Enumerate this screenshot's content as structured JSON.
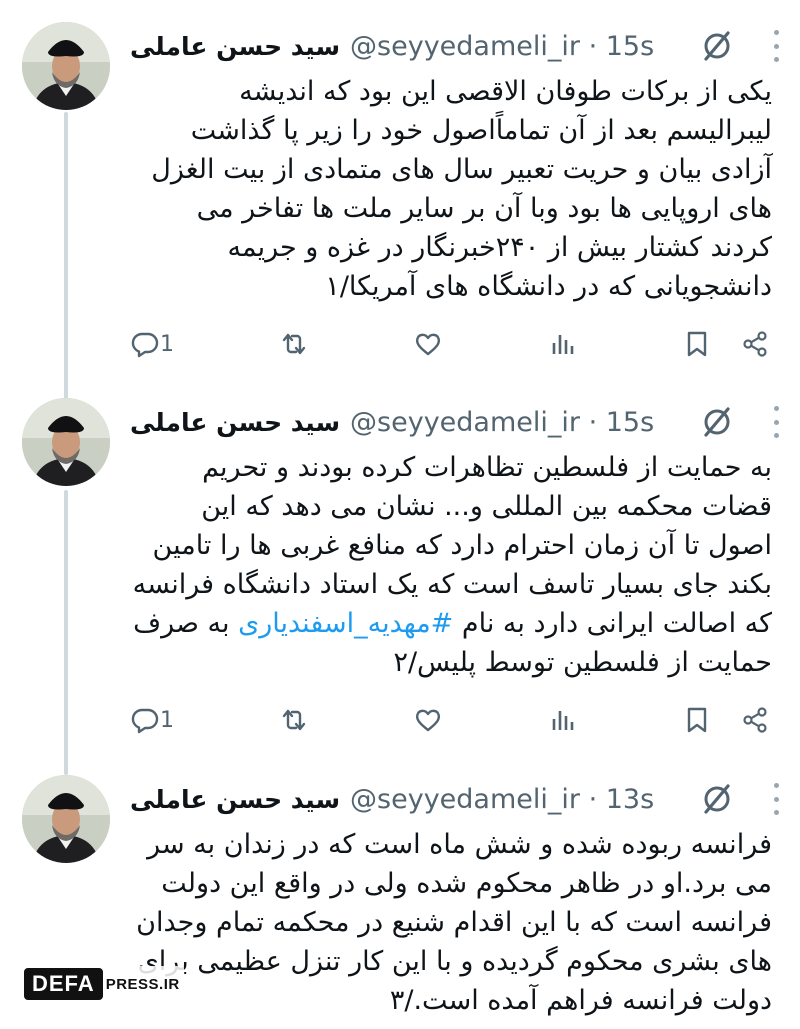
{
  "tweets": [
    {
      "display_name": "سید حسن عاملی",
      "handle": "@seyyedameli_ir · 15s",
      "text": "یکی از برکات طوفان الاقصی این بود که اندیشه لیبرالیسم بعد از آن تماماًاصول خود را زیر پا گذاشت آزادی بیان و حریت تعبیر سال های متمادی از بیت الغزل های اروپایی ها بود وبا آن بر سایر ملت ها تفاخر می کردند کشتار بیش از ۲۴۰خبرنگار در غزه و جریمه دانشجویانی که در دانشگاه های آمریکا/۱",
      "reply_count": "1"
    },
    {
      "display_name": "سید حسن عاملی",
      "handle": "@seyyedameli_ir · 15s",
      "text_before": "به حمایت از فلسطین تظاهرات کرده بودند و تحریم قضات محکمه بین المللی و... نشان می دهد که این اصول تا آن زمان احترام دارد که منافع غربی ها را تامین بکند جای بسیار تاسف است که یک استاد دانشگاه فرانسه که اصالت ایرانی دارد به نام ",
      "hashtag": "#مهدیه_اسفندیاری",
      "text_after": " به صرف حمایت از فلسطین توسط پلیس/۲",
      "reply_count": "1"
    },
    {
      "display_name": "سید حسن عاملی",
      "handle": "@seyyedameli_ir · 13s",
      "text": "فرانسه ربوده شده و شش ماه است که در زندان به سر می برد.او در ظاهر محکوم شده ولی در واقع این دولت فرانسه است که با این اقدام شنیع در محکمه تمام وجدان های بشری محکوم گردیده و با این کار تنزل عظیمی برای دولت فرانسه فراهم آمده است./۳"
    }
  ],
  "icons": [
    "reply-icon",
    "retweet-icon",
    "like-icon",
    "views-icon",
    "bookmark-icon",
    "share-icon",
    "grok-icon",
    "more-icon"
  ],
  "watermark": {
    "box": "DEFA",
    "text": "PRESS.IR"
  },
  "colors": {
    "text": "#0f1419",
    "secondary": "#536471",
    "link": "#1d9bf0",
    "thread_line": "#cfd9de"
  }
}
